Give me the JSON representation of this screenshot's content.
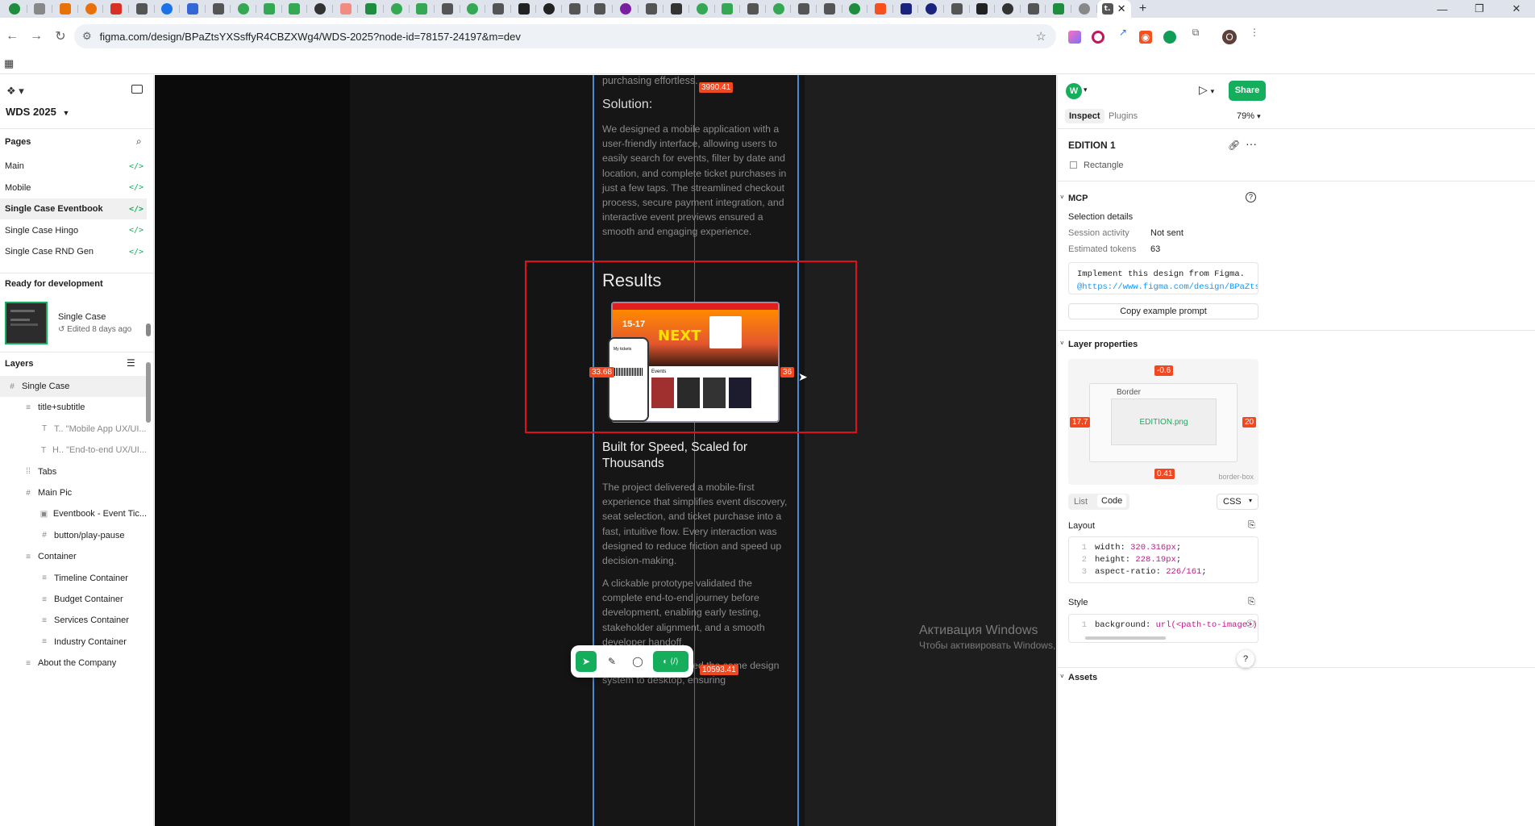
{
  "browser": {
    "tab_count_icons": 43,
    "url": "figma.com/design/BPaZtsYXSsffyR4CBZXWg4/WDS-2025?node-id=78157-24197&m=dev",
    "window_controls": [
      "minimize",
      "restore",
      "close"
    ]
  },
  "left_panel": {
    "file_name": "WDS 2025",
    "pages_label": "Pages",
    "pages": [
      {
        "label": "Main"
      },
      {
        "label": "Mobile"
      },
      {
        "label": "Single Case Eventbook",
        "selected": true
      },
      {
        "label": "Single Case Hingo"
      },
      {
        "label": "Single Case RND Gen"
      }
    ],
    "ready_label": "Ready for development",
    "ready_item": {
      "title": "Single Case",
      "edited": "Edited 8 days ago"
    },
    "layers_label": "Layers",
    "layers": [
      {
        "label": "Single Case",
        "indent": 0,
        "icon": "frame-icon"
      },
      {
        "label": "title+subtitle",
        "indent": 1,
        "icon": "autolayout-icon"
      },
      {
        "label": "T..  \"Mobile App UX/UI...",
        "indent": 2,
        "icon": "text-icon"
      },
      {
        "label": "H..  \"End-to-end UX/UI...",
        "indent": 2,
        "icon": "text-icon"
      },
      {
        "label": "Tabs",
        "indent": 1,
        "icon": "grid-icon"
      },
      {
        "label": "Main Pic",
        "indent": 1,
        "icon": "frame-icon"
      },
      {
        "label": "Eventbook - Event Tic...",
        "indent": 2,
        "icon": "image-icon"
      },
      {
        "label": "button/play-pause",
        "indent": 2,
        "icon": "frame-icon"
      },
      {
        "label": "Container",
        "indent": 1,
        "icon": "autolayout-icon"
      },
      {
        "label": "Timeline Container",
        "indent": 2,
        "icon": "autolayout-icon"
      },
      {
        "label": "Budget Container",
        "indent": 2,
        "icon": "autolayout-icon"
      },
      {
        "label": "Services Container",
        "indent": 2,
        "icon": "autolayout-icon"
      },
      {
        "label": "Industry Container",
        "indent": 2,
        "icon": "autolayout-icon"
      },
      {
        "label": "About the Company",
        "indent": 1,
        "icon": "autolayout-icon"
      }
    ]
  },
  "canvas": {
    "top_text": "purchasing effortless.",
    "solution_heading": "Solution:",
    "solution_body": "We designed a mobile application with a user-friendly interface, allowing users to easily search for events, filter by date and location, and complete ticket purchases in just a few taps. The streamlined checkout process, secure payment integration, and interactive event previews ensured a smooth and engaging experience.",
    "results_heading": "Results",
    "built_heading": "Built for Speed, Scaled for Thousands",
    "built_body_1": "The project delivered a mobile-first experience that simplifies event discovery, seat selection, and ticket purchase into a fast, intuitive flow. Every interaction was designed to reduce friction and speed up decision-making.",
    "built_body_2": "A clickable prototype validated the complete end-to-end journey before development, enabling early testing, stakeholder alignment, and a smooth developer handoff.",
    "bottom_text": "The interface extended the same design system to desktop, ensuring",
    "measure_top": "3990.41",
    "measure_left": "33.68",
    "measure_right": "36",
    "measure_bottom": "10593.41",
    "mockup": {
      "date": "15-17",
      "tag": "NEXT",
      "events_label": "Events",
      "tickets_label": "My tickets"
    },
    "watermark_title": "Активация Windows",
    "watermark_body": "Чтобы активировать Windows, перейдите в раздел \"Параметры\"."
  },
  "right_panel": {
    "avatar_letter": "W",
    "share_label": "Share",
    "tabs": [
      "Inspect",
      "Plugins"
    ],
    "active_tab": "Inspect",
    "zoom": "79%",
    "layer_name": "EDITION 1",
    "layer_type": "Rectangle",
    "mcp_label": "MCP",
    "selection_details": "Selection details",
    "session_activity_label": "Session activity",
    "session_activity_value": "Not sent",
    "tokens_label": "Estimated tokens",
    "tokens_value": "63",
    "prompt_line1": "Implement this design from Figma.",
    "prompt_line2": "@https://www.figma.com/design/BPaZtsYX…",
    "copy_prompt_label": "Copy example prompt",
    "layer_props_label": "Layer properties",
    "box_top": "-0.6",
    "box_left": "17.7",
    "box_right": "20",
    "box_bottom": "0.41",
    "border_label": "Border",
    "box_content": "EDITION.png",
    "box_sizing": "border-box",
    "list_label": "List",
    "code_label": "Code",
    "css_label": "CSS",
    "layout_label": "Layout",
    "layout_code": [
      {
        "prop": "width: ",
        "val": "320.316px",
        "end": ";"
      },
      {
        "prop": "height: ",
        "val": "228.19px",
        "end": ";"
      },
      {
        "prop": "aspect-ratio: ",
        "val": "226/161",
        "end": ";"
      }
    ],
    "style_label": "Style",
    "style_code": {
      "prop": "background: ",
      "val": "url(<path-to-image>) li"
    },
    "assets_label": "Assets"
  },
  "toolbar": {
    "tools": [
      "move-tool",
      "pen-tool",
      "comment-tool",
      "dev-mode-toggle"
    ]
  }
}
